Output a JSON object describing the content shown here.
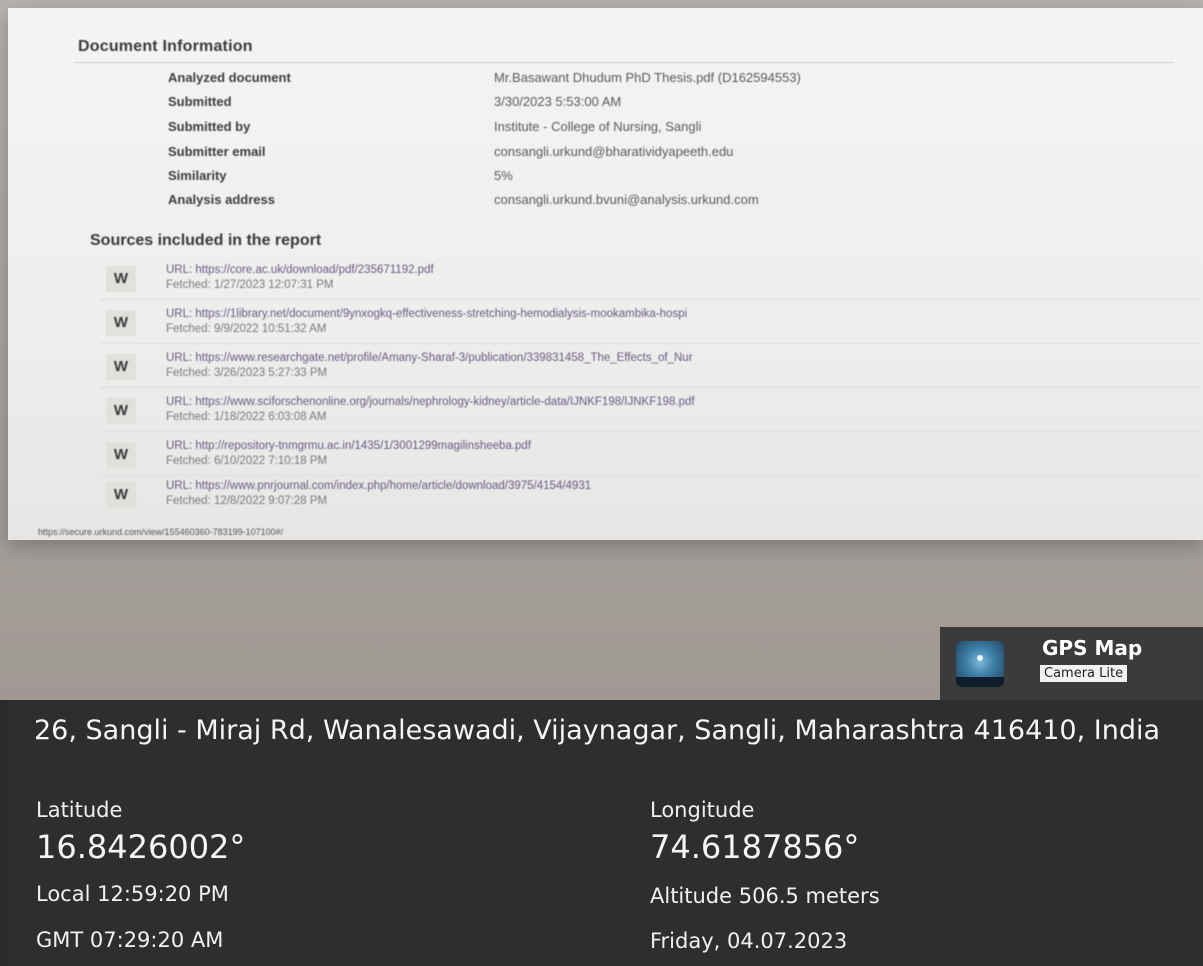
{
  "document": {
    "title": "Document Information",
    "rows": [
      {
        "label": "Analyzed document",
        "value": "Mr.Basawant Dhudum PhD Thesis.pdf (D162594553)"
      },
      {
        "label": "Submitted",
        "value": "3/30/2023 5:53:00 AM"
      },
      {
        "label": "Submitted by",
        "value": "Institute - College of Nursing, Sangli"
      },
      {
        "label": "Submitter email",
        "value": "consangli.urkund@bharatividyapeeth.edu"
      },
      {
        "label": "Similarity",
        "value": "5%"
      },
      {
        "label": "Analysis address",
        "value": "consangli.urkund.bvuni@analysis.urkund.com"
      }
    ]
  },
  "sources": {
    "title": "Sources included in the report",
    "items": [
      {
        "badge": "W",
        "url": "URL: https://core.ac.uk/download/pdf/235671192.pdf",
        "fetched": "Fetched: 1/27/2023 12:07:31 PM"
      },
      {
        "badge": "W",
        "url": "URL: https://1library.net/document/9ynxogkq-effectiveness-stretching-hemodialysis-mookambika-hospi",
        "fetched": "Fetched: 9/9/2022 10:51:32 AM"
      },
      {
        "badge": "W",
        "url": "URL: https://www.researchgate.net/profile/Amany-Sharaf-3/publication/339831458_The_Effects_of_Nur",
        "fetched": "Fetched: 3/26/2023 5:27:33 PM"
      },
      {
        "badge": "W",
        "url": "URL: https://www.sciforschenonline.org/journals/nephrology-kidney/article-data/IJNKF198/IJNKF198.pdf",
        "fetched": "Fetched: 1/18/2022 6:03:08 AM"
      },
      {
        "badge": "W",
        "url": "URL: http://repository-tnmgrmu.ac.in/1435/1/3001299magilinsheeba.pdf",
        "fetched": "Fetched: 6/10/2022 7:10:18 PM"
      },
      {
        "badge": "W",
        "url": "URL: https://www.pnrjournal.com/index.php/home/article/download/3975/4154/4931",
        "fetched": "Fetched: 12/8/2022 9:07:28 PM"
      }
    ]
  },
  "status_url": "https://secure.urkund.com/view/155460360-783199-107100#/",
  "gps": {
    "app_title": "GPS Map",
    "app_subtitle": "Camera Lite",
    "icon": "gps-map-app-icon",
    "address": "26, Sangli - Miraj Rd, Wanalesawadi, Vijaynagar, Sangli, Maharashtra 416410, India",
    "latitude_label": "Latitude",
    "latitude": "16.8426002°",
    "longitude_label": "Longitude",
    "longitude": "74.6187856°",
    "local_time": "Local  12:59:20 PM",
    "gmt_time": "GMT  07:29:20 AM",
    "altitude": "Altitude  506.5 meters",
    "date": "Friday, 04.07.2023"
  }
}
